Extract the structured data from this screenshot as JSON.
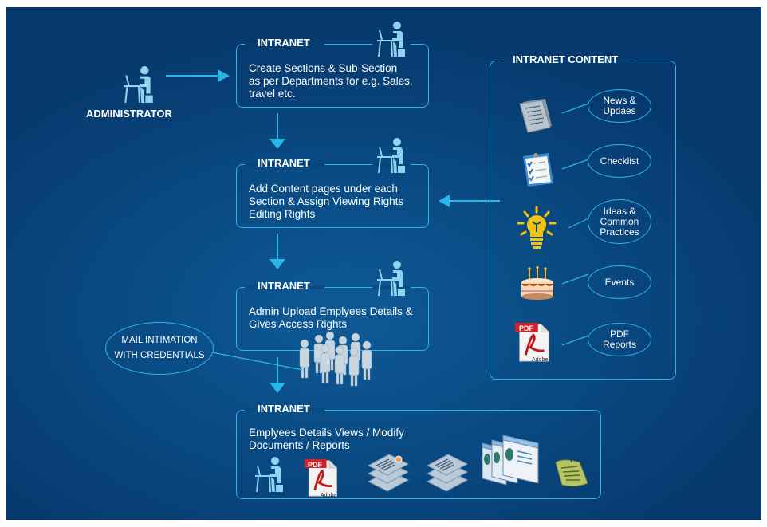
{
  "colors": {
    "background": "#0a4a82",
    "accent": "#29b6e8",
    "text": "#ffffff",
    "person_icon": "#8fd3f0"
  },
  "administrator": {
    "label": "ADMINISTRATOR",
    "icon": "person-at-laptop-icon"
  },
  "steps": [
    {
      "title": "INTRANET",
      "lines": [
        "Create Sections & Sub-Section",
        "as per Departments for e.g. Sales,",
        "travel etc."
      ],
      "icon": "person-at-laptop-icon"
    },
    {
      "title": "INTRANET",
      "lines": [
        "Add Content pages under each",
        "Section & Assign Viewing Rights",
        "Editing Rights"
      ],
      "icon": "person-at-laptop-icon"
    },
    {
      "title": "INTRANET",
      "lines": [
        "Admin Upload Emplyees Details &",
        "Gives Access Rights"
      ],
      "icon": "person-at-laptop-icon"
    },
    {
      "title": "INTRANET",
      "lines": [
        "Emplyees Details Views / Modify",
        "Documents / Reports"
      ],
      "icons": [
        "person-at-laptop-icon",
        "pdf-icon",
        "document-stack-icon",
        "document-stack-icon",
        "web-pages-icon",
        "note-icon"
      ]
    }
  ],
  "mail_note": {
    "lines": [
      "MAIL INTIMATION",
      "WITH CREDENTIALS"
    ],
    "icon": "employees-group-icon"
  },
  "content_panel": {
    "title": "INTRANET CONTENT",
    "items": [
      {
        "lines": [
          "News &",
          "Updaes"
        ],
        "icon": "news-documents-icon"
      },
      {
        "lines": [
          "Checklist"
        ],
        "icon": "checklist-clipboard-icon"
      },
      {
        "lines": [
          "Ideas &",
          "Common",
          "Practices"
        ],
        "icon": "lightbulb-icon"
      },
      {
        "lines": [
          "Events"
        ],
        "icon": "birthday-cake-icon"
      },
      {
        "lines": [
          "PDF",
          "Reports"
        ],
        "icon": "pdf-icon"
      }
    ]
  },
  "pdf_icon": {
    "badge": "PDF",
    "brand": "Adobe"
  }
}
